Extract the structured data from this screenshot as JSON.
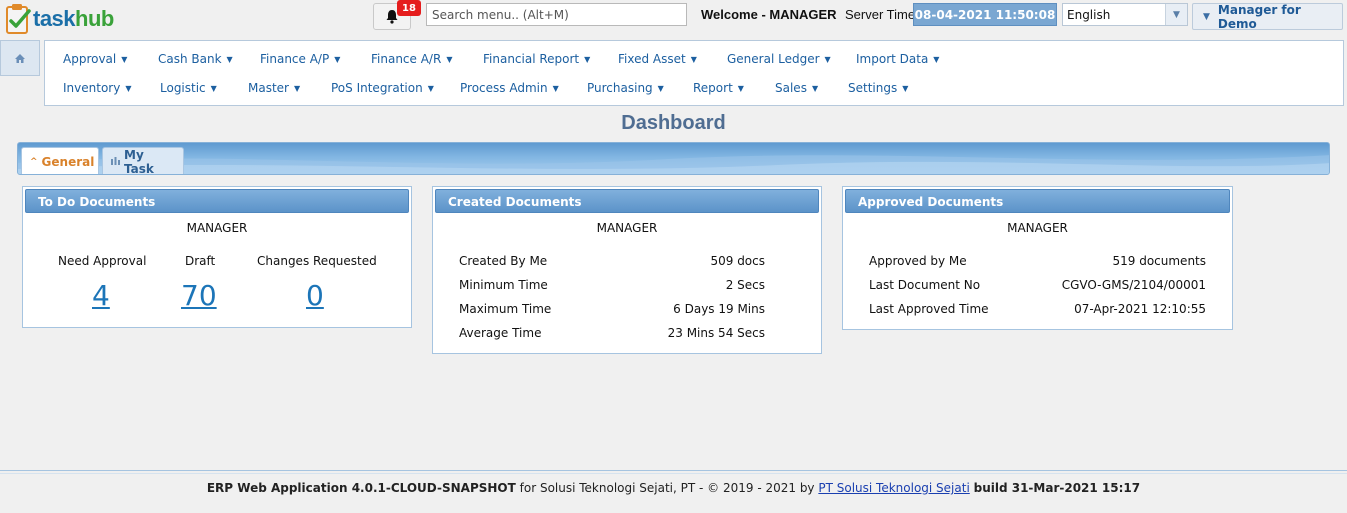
{
  "app": {
    "logo_part1": "task",
    "logo_part2": "hub"
  },
  "header": {
    "notification_count": "18",
    "search_placeholder": "Search menu.. (Alt+M)",
    "welcome": "Welcome - MANAGER",
    "server_time_label": "Server Time",
    "server_time": "08-04-2021 11:50:08",
    "language": "English",
    "user_button": "Manager for Demo"
  },
  "menu": {
    "row1": [
      "Approval",
      "Cash Bank",
      "Finance A/P",
      "Finance A/R",
      "Financial Report",
      "Fixed Asset",
      "General Ledger",
      "Import Data"
    ],
    "row2": [
      "Inventory",
      "Logistic",
      "Master",
      "PoS Integration",
      "Process Admin",
      "Purchasing",
      "Report",
      "Sales",
      "Settings"
    ]
  },
  "dashboard": {
    "title": "Dashboard",
    "tabs": [
      {
        "label": "General"
      },
      {
        "label": "My Task"
      }
    ]
  },
  "todo": {
    "title": "To Do Documents",
    "user": "MANAGER",
    "stats": [
      {
        "label": "Need Approval",
        "value": "4"
      },
      {
        "label": "Draft",
        "value": "70"
      },
      {
        "label": "Changes Requested",
        "value": "0"
      }
    ]
  },
  "created": {
    "title": "Created Documents",
    "user": "MANAGER",
    "rows": [
      {
        "label": "Created By Me",
        "value": "509 docs"
      },
      {
        "label": "Minimum Time",
        "value": "2 Secs"
      },
      {
        "label": "Maximum Time",
        "value": "6 Days 19 Mins"
      },
      {
        "label": "Average Time",
        "value": "23 Mins 54 Secs"
      }
    ]
  },
  "approved": {
    "title": "Approved Documents",
    "user": "MANAGER",
    "rows": [
      {
        "label": "Approved by Me",
        "value": "519 documents"
      },
      {
        "label": "Last Document No",
        "value": "CGVO-GMS/2104/00001"
      },
      {
        "label": "Last Approved Time",
        "value": "07-Apr-2021 12:10:55"
      }
    ]
  },
  "footer": {
    "app_name": "ERP Web Application 4.0.1-CLOUD-SNAPSHOT",
    "for_text": "for Solusi Teknologi Sejati, PT - © 2019 - 2021 by",
    "company_link": "PT Solusi Teknologi Sejati",
    "build": "build 31-Mar-2021 15:17"
  },
  "colors": {
    "accent": "#1c5fa0",
    "badge": "#e51d1d",
    "tab_active": "#d9822b",
    "stat_link": "#1c75b8"
  }
}
